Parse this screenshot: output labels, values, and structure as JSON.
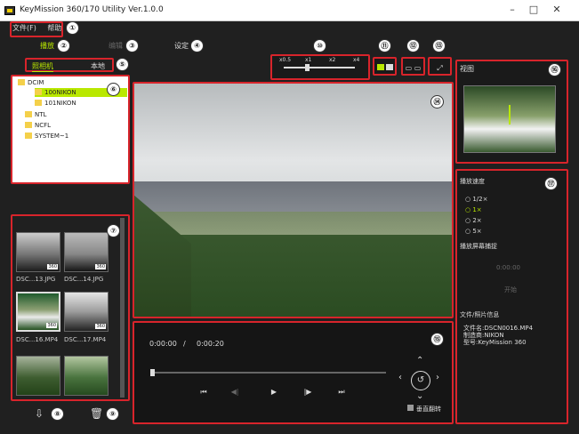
{
  "window": {
    "title": "KeyMission 360/170 Utility Ver.1.0.0",
    "controls": [
      "–",
      "□",
      "✕"
    ]
  },
  "menu": {
    "items": [
      "文件(F)",
      "帮助"
    ]
  },
  "modes": {
    "items": [
      "播放",
      "编辑",
      "设定"
    ]
  },
  "source_tabs": [
    "照相机",
    "本地"
  ],
  "folder_tree": [
    {
      "label": "DCIM"
    },
    {
      "label": "100NIKON",
      "selected": true
    },
    {
      "label": "101NIKON"
    },
    {
      "label": "NTL"
    },
    {
      "label": "NCFL"
    },
    {
      "label": "SYSTEM~1"
    }
  ],
  "thumbnails": [
    {
      "label": "DSC...13.JPG",
      "badge": "360"
    },
    {
      "label": "DSC...14.JPG",
      "badge": "360"
    },
    {
      "label": "DSC...16.MP4",
      "badge": "360"
    },
    {
      "label": "DSC...17.MP4",
      "badge": "360"
    },
    {
      "label": "",
      "badge": ""
    },
    {
      "label": "",
      "badge": ""
    }
  ],
  "zoom": {
    "labels": [
      "x0.5",
      "x1",
      "x2",
      "x4"
    ],
    "value": 0.3
  },
  "playback": {
    "current_time": "0:00:00",
    "separator": "/",
    "total_time": "0:00:20",
    "buttons": [
      "⏮",
      "◀|",
      "▶",
      "|▶",
      "⏭"
    ],
    "flip_label": "垂直翻转"
  },
  "view": {
    "title": "视图"
  },
  "speed": {
    "title": "播放速度",
    "items": [
      "1/2×",
      "1×",
      "2×",
      "5×"
    ],
    "selected_index": 1
  },
  "capture": {
    "title": "播放屏幕捕捉",
    "time": "0:00:00",
    "button": "开始"
  },
  "file_info": {
    "title": "文件/照片信息",
    "lines": [
      "文件名:DSCN0016.MP4",
      "制造商:NIKON",
      "型号:KeyMission 360"
    ]
  },
  "callouts": [
    "①",
    "②",
    "③",
    "④",
    "⑤",
    "⑥",
    "⑦",
    "⑧",
    "⑨",
    "⑩",
    "⑪",
    "⑫",
    "⑬",
    "⑭",
    "⑮",
    "⑯",
    "⑰"
  ],
  "colors": {
    "accent": "#b9e800",
    "callout_red": "#d8242b",
    "background": "#202020"
  }
}
